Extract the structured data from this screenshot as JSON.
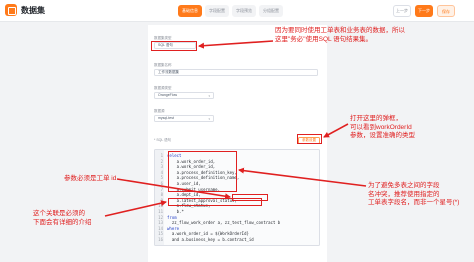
{
  "app": {
    "title": "数据集"
  },
  "steps": [
    "基础信息",
    "字段配置",
    "字段预览",
    "分组配置"
  ],
  "header_actions": {
    "prev": "上一步",
    "next": "下一步",
    "save": "保存"
  },
  "form": {
    "mode_label": "数据集类型",
    "mode_value": "SQL 语句",
    "name_label": "数据集名称",
    "name_value": "工作流数据集",
    "ds_type_label": "数据源类型",
    "ds_type_value": "OrangeFlow",
    "ds_label": "数据源",
    "ds_value": "mysql-test",
    "sql_label": "* SQL 语句",
    "sql_button": "参数设置"
  },
  "sql_lines": [
    {
      "n": "1",
      "text": "select"
    },
    {
      "n": "2",
      "text": "    a.work_order_id,"
    },
    {
      "n": "3",
      "text": "    a.work_order_id,"
    },
    {
      "n": "4",
      "text": "    a.process_definition_key,"
    },
    {
      "n": "5",
      "text": "    a.process_definition_name,"
    },
    {
      "n": "6",
      "text": "    a.user_id,"
    },
    {
      "n": "7",
      "text": "    a.submit_username,"
    },
    {
      "n": "8",
      "text": "    a.dept_id,"
    },
    {
      "n": "9",
      "text": "    a.latest_approval_status,"
    },
    {
      "n": "10",
      "text": "    a.flow_status,"
    },
    {
      "n": "11",
      "text": "    b.*"
    },
    {
      "n": "12",
      "text": "from"
    },
    {
      "n": "13",
      "text": "  zz_flow_work_order a, zz_test_flow_contract b"
    },
    {
      "n": "14",
      "text": "where"
    },
    {
      "n": "15",
      "text": "  a.work_order_id = ${WorkOrderId}"
    },
    {
      "n": "16",
      "text": "  and a.business_key = b.contract_id"
    }
  ],
  "annotations": {
    "note_sql_mode": [
      "因为要同时使用工单表和业务表的数据，所以",
      "这里\"务必\"使用SQL 语句结果集。"
    ],
    "note_param": [
      "打开这里的弹框，",
      "可以看到workOrderId",
      "参数，设置准确的类型"
    ],
    "note_workorder": [
      "参数必须是工单 id"
    ],
    "note_columns": [
      "为了避免多表之间的字段",
      "名冲突，推荐使用指定的",
      "工单表字段名，而非一个星号(*)"
    ],
    "note_join": [
      "这个关联是必须的",
      "下面会有详细的介绍"
    ]
  },
  "colors": {
    "accent": "#ff7a1a",
    "annotation": "#e02020"
  }
}
